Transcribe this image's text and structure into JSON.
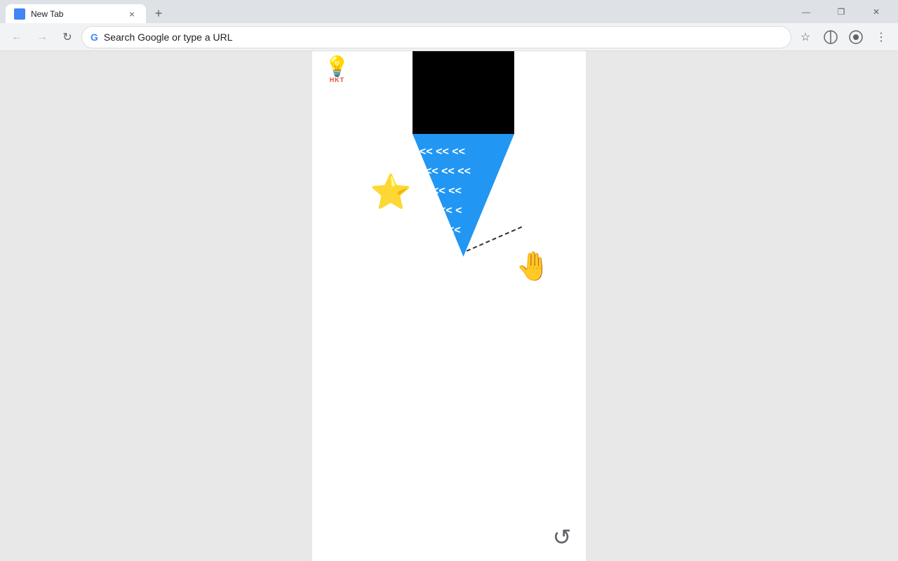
{
  "titlebar": {
    "tab_label": "New Tab",
    "tab_close_icon": "×",
    "new_tab_icon": "+",
    "window_controls": {
      "minimize": "—",
      "maximize": "❐",
      "close": "✕"
    }
  },
  "toolbar": {
    "back_label": "←",
    "forward_label": "→",
    "refresh_label": "↻",
    "search_placeholder": "Search Google or type a URL",
    "bookmark_icon": "☆",
    "profile_icon": "⊘",
    "extension_icon": "⚙",
    "menu_icon": "⋮"
  },
  "canvas": {
    "hkt_text": "HKT",
    "black_rect": "black rectangle",
    "blue_triangle": "blue triangle",
    "star_emoji": "⭐",
    "refresh_icon": "↺"
  }
}
